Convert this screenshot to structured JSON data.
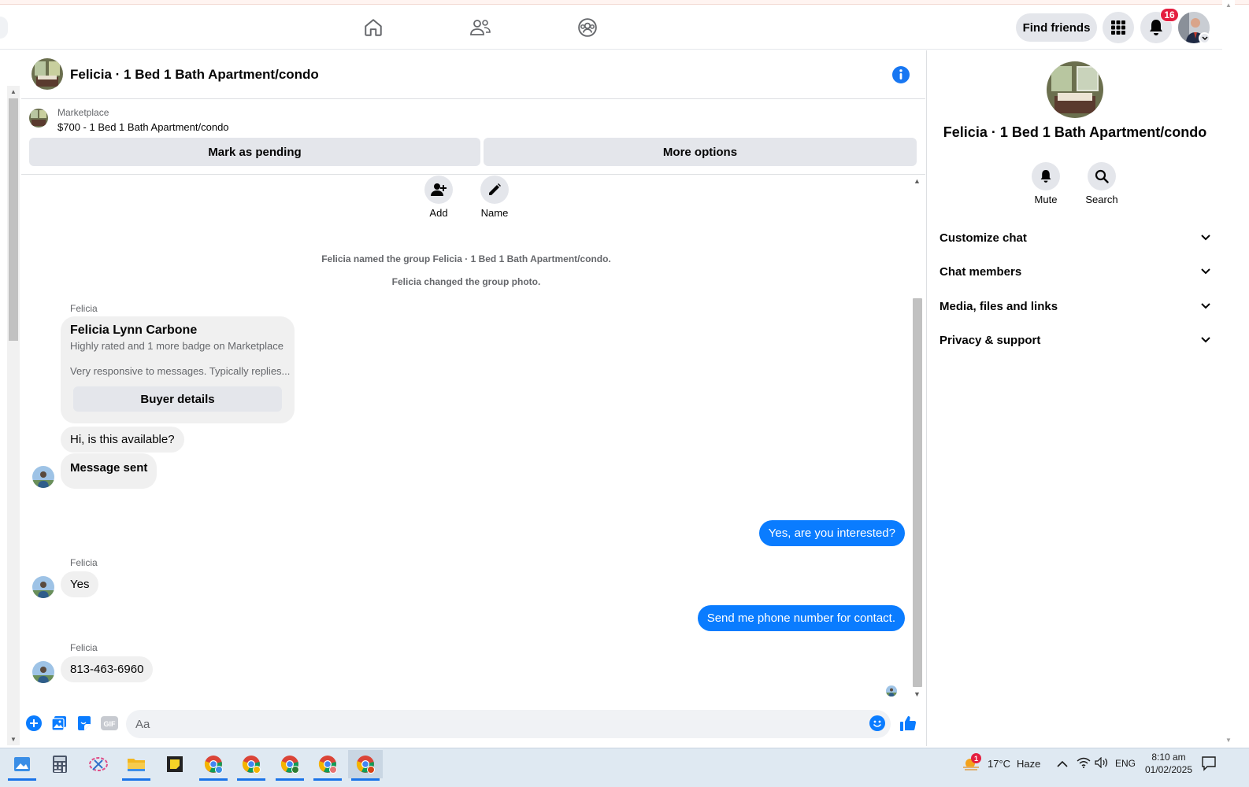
{
  "topbar": {
    "find_friends_label": "Find friends",
    "notification_count": "16"
  },
  "chat": {
    "title": "Felicia · 1 Bed 1 Bath Apartment/condo",
    "marketplace_label": "Marketplace",
    "listing_title": "$700 - 1 Bed 1 Bath Apartment/condo",
    "mark_pending_label": "Mark as pending",
    "more_options_label": "More options"
  },
  "actions": {
    "add_label": "Add",
    "name_label": "Name"
  },
  "system_messages": [
    "Felicia named the group Felicia · 1 Bed 1 Bath Apartment/condo.",
    "Felicia changed the group photo."
  ],
  "buyer_card": {
    "sender": "Felicia",
    "name": "Felicia Lynn Carbone",
    "line1": "Highly rated and 1 more badge on Marketplace",
    "line2": "Very responsive to messages. Typically replies...",
    "button_label": "Buyer details"
  },
  "messages": [
    {
      "direction": "in",
      "text": "Hi, is this available?"
    },
    {
      "direction": "in",
      "text": "Message sent"
    },
    {
      "direction": "out",
      "text": "Yes, are you interested?"
    },
    {
      "direction": "in",
      "sender": "Felicia",
      "text": "Yes"
    },
    {
      "direction": "out",
      "text": "Send me phone number for contact."
    },
    {
      "direction": "in",
      "sender": "Felicia",
      "text": "813-463-6960"
    }
  ],
  "composer": {
    "placeholder": "Aa"
  },
  "right_pane": {
    "title": "Felicia · 1 Bed 1 Bath Apartment/condo",
    "mute_label": "Mute",
    "search_label": "Search",
    "sections": [
      "Customize chat",
      "Chat members",
      "Media, files and links",
      "Privacy & support"
    ]
  },
  "taskbar": {
    "weather_temp": "17°C",
    "weather_desc": "Haze",
    "weather_badge": "1",
    "language": "ENG",
    "time": "8:10 am",
    "date": "01/02/2025"
  },
  "colors": {
    "accent": "#0a7cff",
    "info_blue": "#1877f2",
    "badge_red": "#e41e3f",
    "bubble_in": "#f0f0f0"
  }
}
